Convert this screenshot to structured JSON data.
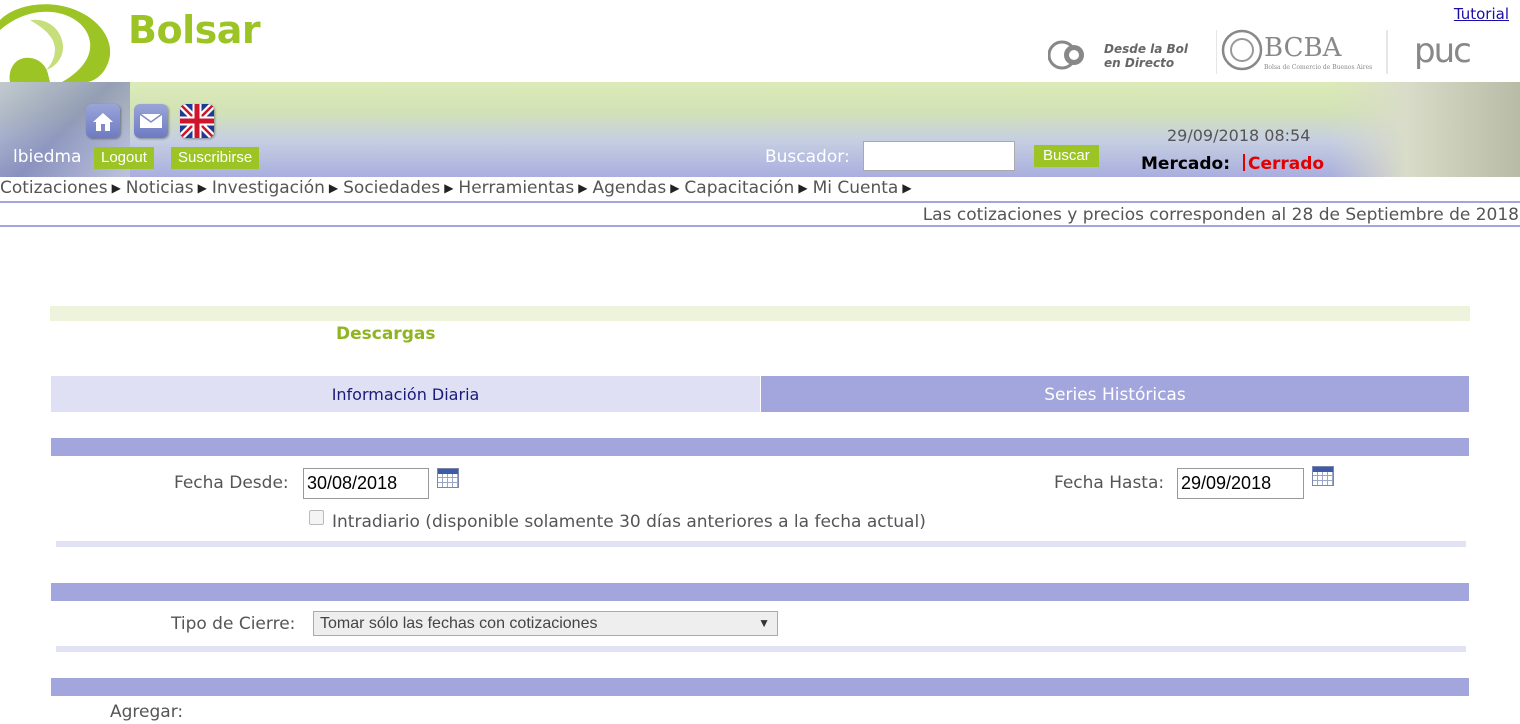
{
  "header": {
    "brand": "Bolsar",
    "tutorial_link": "Tutorial",
    "partners": {
      "p1_line1": "Desde la Bolsa",
      "p1_line2": "en Directo",
      "p2_name": "BCBA",
      "p2_sub": "Bolsa de Comercio de Buenos Aires",
      "p3_name": "puc"
    }
  },
  "toolbar": {
    "icons": [
      "home-icon",
      "mail-icon",
      "uk-flag-icon"
    ],
    "username": "lbiedma",
    "logout_label": "Logout",
    "subscribe_label": "Suscribirse",
    "search_label": "Buscador:",
    "search_value": "",
    "search_button": "Buscar",
    "datetime": "29/09/2018 08:54",
    "market_label": "Mercado:",
    "market_status": "Cerrado",
    "market_status_color": "#e30000"
  },
  "nav": {
    "items": [
      "Cotizaciones",
      "Noticias",
      "Investigación",
      "Sociedades",
      "Herramientas",
      "Agendas",
      "Capacitación",
      "Mi Cuenta"
    ]
  },
  "notice": "Las cotizaciones y precios corresponden al 28 de Septiembre de 2018",
  "main": {
    "section_title": "Descargas",
    "tabs": [
      {
        "label": "Información Diaria",
        "active": false
      },
      {
        "label": "Series Históricas",
        "active": true
      }
    ],
    "fecha_desde_label": "Fecha Desde:",
    "fecha_desde_value": "30/08/2018",
    "fecha_hasta_label": "Fecha Hasta:",
    "fecha_hasta_value": "29/09/2018",
    "intradiario_label": "Intradiario (disponible solamente 30 días anteriores a la fecha actual)",
    "intradiario_checked": false,
    "tipo_cierre_label": "Tipo de Cierre:",
    "tipo_cierre_value": "Tomar sólo las fechas con cotizaciones",
    "agregar_label": "Agregar:"
  },
  "colors": {
    "brand_green": "#9bc424",
    "lavender": "#a3a6dc",
    "pale_lavender": "#dfe0f3"
  }
}
